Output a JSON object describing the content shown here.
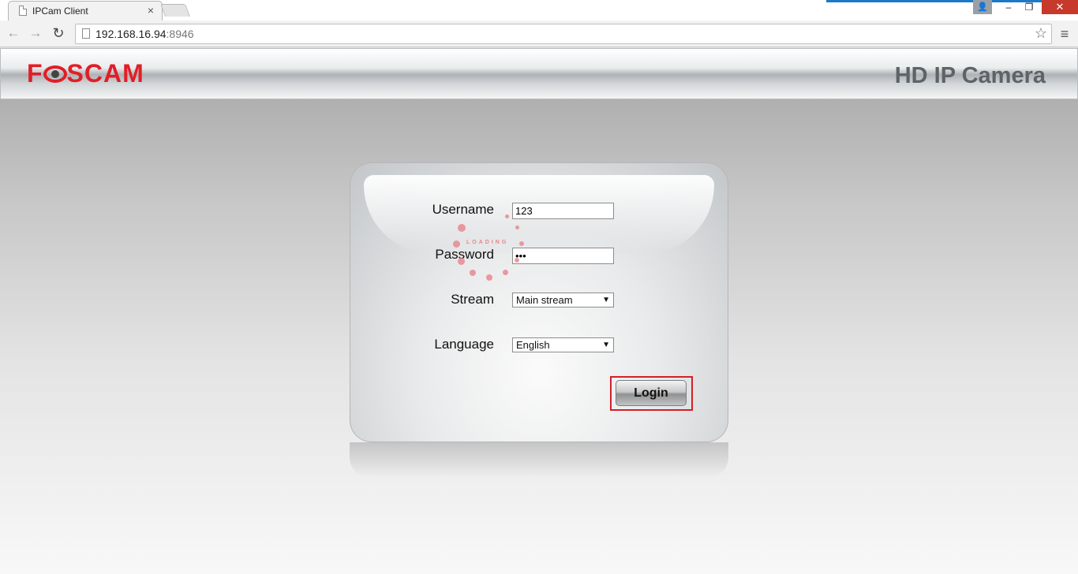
{
  "browser": {
    "tab_title": "IPCam Client",
    "tab_close": "×",
    "url_host": "192.168.16.94",
    "url_port": ":8946",
    "back_icon": "←",
    "forward_icon": "→",
    "reload_icon": "↻",
    "star_icon": "☆",
    "menu_icon": "≡",
    "user_icon": "👤",
    "min_icon": "–",
    "max_icon": "❐",
    "close_icon": "✕"
  },
  "header": {
    "logo_left": "F",
    "logo_right": "SCAM",
    "title": "HD IP Camera"
  },
  "login": {
    "username_label": "Username",
    "username_value": "123",
    "password_label": "Password",
    "password_value": "abc",
    "stream_label": "Stream",
    "stream_value": "Main stream",
    "language_label": "Language",
    "language_value": "English",
    "loading_text": "LOADING",
    "login_button": "Login"
  },
  "colors": {
    "brand_red": "#e21e26",
    "focus_outline": "#d32029",
    "title_gray": "#5d6468"
  }
}
